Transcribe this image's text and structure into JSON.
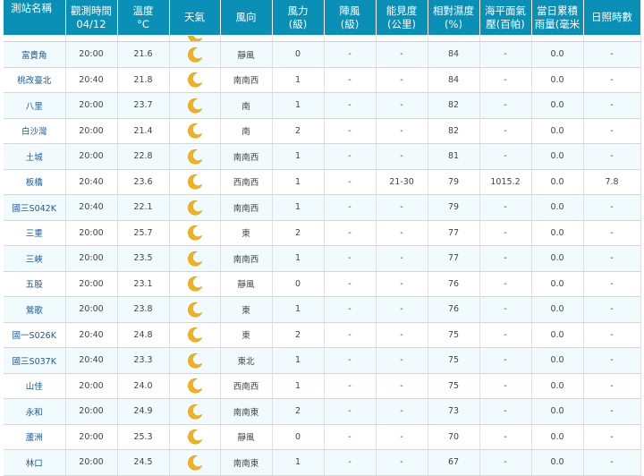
{
  "headers": {
    "station": "測站名稱",
    "time_line1": "觀測時間",
    "time_line2": "04/12",
    "temp_line1": "溫度",
    "temp_line2": "°C",
    "weather": "天氣",
    "wind_dir": "風向",
    "wind_force_line1": "風力",
    "wind_force_line2": "(級)",
    "gust_line1": "陣風",
    "gust_line2": "(級)",
    "visibility_line1": "能見度",
    "visibility_line2": "(公里)",
    "humidity_line1": "相對濕度",
    "humidity_line2": "(%)",
    "pressure_line1": "海平面氣",
    "pressure_line2": "壓(百帕)",
    "rain_line1": "當日累積",
    "rain_line2": "雨量(毫米",
    "sunshine": "日照時數"
  },
  "weather_icon": "crescent-moon-icon",
  "colors": {
    "header_bg": "#0a8fb7",
    "header_text": "#ffffff",
    "station_link": "#1a5aa0",
    "row_alt": "#f1fbfd",
    "moon": "#f2b21c"
  },
  "rows": [
    {
      "station": "富貴角",
      "time": "20:00",
      "temp": "21.6",
      "wind_dir": "靜風",
      "wind_force": "0",
      "gust": "-",
      "visibility": "-",
      "humidity": "84",
      "pressure": "-",
      "rain": "0.0",
      "sunshine": "-"
    },
    {
      "station": "桃改臺北",
      "time": "20:40",
      "temp": "21.8",
      "wind_dir": "南南西",
      "wind_force": "1",
      "gust": "-",
      "visibility": "-",
      "humidity": "84",
      "pressure": "-",
      "rain": "0.0",
      "sunshine": "-"
    },
    {
      "station": "八里",
      "time": "20:00",
      "temp": "23.7",
      "wind_dir": "南",
      "wind_force": "1",
      "gust": "-",
      "visibility": "-",
      "humidity": "82",
      "pressure": "-",
      "rain": "0.0",
      "sunshine": "-"
    },
    {
      "station": "白沙灣",
      "time": "20:00",
      "temp": "21.4",
      "wind_dir": "南",
      "wind_force": "2",
      "gust": "-",
      "visibility": "-",
      "humidity": "82",
      "pressure": "-",
      "rain": "0.0",
      "sunshine": "-"
    },
    {
      "station": "土城",
      "time": "20:00",
      "temp": "22.8",
      "wind_dir": "南南西",
      "wind_force": "1",
      "gust": "-",
      "visibility": "-",
      "humidity": "81",
      "pressure": "-",
      "rain": "0.0",
      "sunshine": "-"
    },
    {
      "station": "板橋",
      "time": "20:40",
      "temp": "23.6",
      "wind_dir": "西南西",
      "wind_force": "1",
      "gust": "-",
      "visibility": "21-30",
      "humidity": "79",
      "pressure": "1015.2",
      "rain": "0.0",
      "sunshine": "7.8"
    },
    {
      "station": "國三S042K",
      "time": "20:40",
      "temp": "22.1",
      "wind_dir": "南南西",
      "wind_force": "1",
      "gust": "-",
      "visibility": "-",
      "humidity": "79",
      "pressure": "-",
      "rain": "0.0",
      "sunshine": "-"
    },
    {
      "station": "三重",
      "time": "20:00",
      "temp": "25.7",
      "wind_dir": "東",
      "wind_force": "2",
      "gust": "-",
      "visibility": "-",
      "humidity": "77",
      "pressure": "-",
      "rain": "0.0",
      "sunshine": "-"
    },
    {
      "station": "三峽",
      "time": "20:00",
      "temp": "23.5",
      "wind_dir": "南南西",
      "wind_force": "1",
      "gust": "-",
      "visibility": "-",
      "humidity": "77",
      "pressure": "-",
      "rain": "0.0",
      "sunshine": "-"
    },
    {
      "station": "五股",
      "time": "20:00",
      "temp": "23.1",
      "wind_dir": "靜風",
      "wind_force": "0",
      "gust": "-",
      "visibility": "-",
      "humidity": "76",
      "pressure": "-",
      "rain": "0.0",
      "sunshine": "-"
    },
    {
      "station": "鶯歌",
      "time": "20:00",
      "temp": "23.8",
      "wind_dir": "東",
      "wind_force": "1",
      "gust": "-",
      "visibility": "-",
      "humidity": "76",
      "pressure": "-",
      "rain": "0.0",
      "sunshine": "-"
    },
    {
      "station": "國一S026K",
      "time": "20:40",
      "temp": "24.8",
      "wind_dir": "東",
      "wind_force": "2",
      "gust": "-",
      "visibility": "-",
      "humidity": "75",
      "pressure": "-",
      "rain": "0.0",
      "sunshine": "-"
    },
    {
      "station": "國三S037K",
      "time": "20:40",
      "temp": "23.3",
      "wind_dir": "東北",
      "wind_force": "1",
      "gust": "-",
      "visibility": "-",
      "humidity": "75",
      "pressure": "-",
      "rain": "0.0",
      "sunshine": "-"
    },
    {
      "station": "山佳",
      "time": "20:00",
      "temp": "24.0",
      "wind_dir": "西南西",
      "wind_force": "1",
      "gust": "-",
      "visibility": "-",
      "humidity": "75",
      "pressure": "-",
      "rain": "0.0",
      "sunshine": "-"
    },
    {
      "station": "永和",
      "time": "20:00",
      "temp": "24.9",
      "wind_dir": "南南東",
      "wind_force": "2",
      "gust": "-",
      "visibility": "-",
      "humidity": "73",
      "pressure": "-",
      "rain": "0.0",
      "sunshine": "-"
    },
    {
      "station": "蘆洲",
      "time": "20:00",
      "temp": "25.3",
      "wind_dir": "靜風",
      "wind_force": "0",
      "gust": "-",
      "visibility": "-",
      "humidity": "70",
      "pressure": "-",
      "rain": "0.0",
      "sunshine": "-"
    },
    {
      "station": "林口",
      "time": "20:00",
      "temp": "24.5",
      "wind_dir": "南南東",
      "wind_force": "1",
      "gust": "-",
      "visibility": "-",
      "humidity": "67",
      "pressure": "-",
      "rain": "0.0",
      "sunshine": "-"
    }
  ]
}
